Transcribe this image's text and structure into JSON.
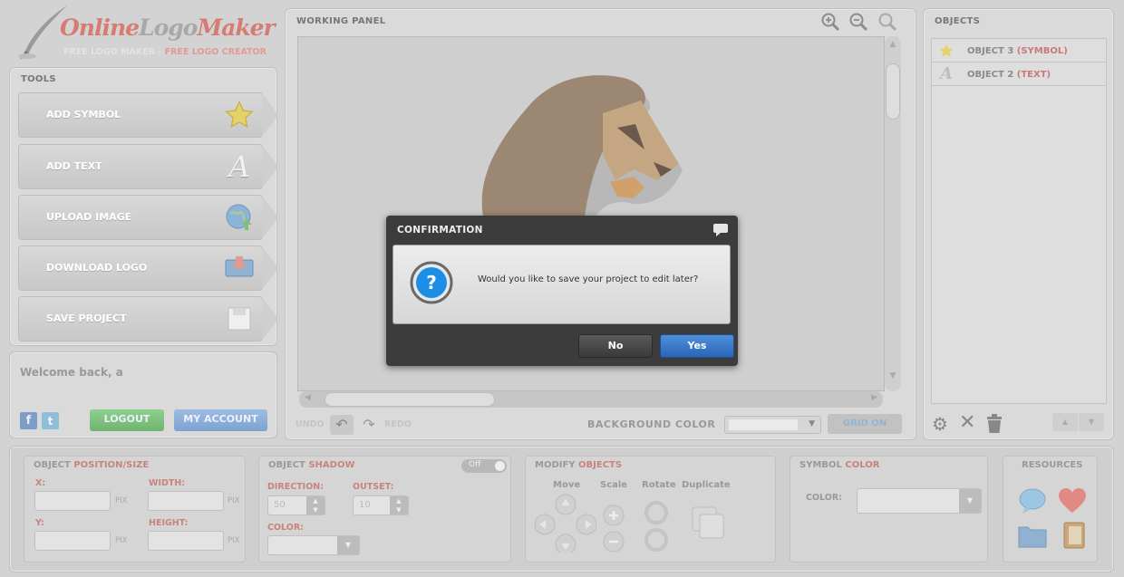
{
  "logo": {
    "brand_a": "Online",
    "brand_b": "Logo",
    "brand_c": "Maker",
    "sub_a": "FREE LOGO MAKER",
    "sub_sep": " - ",
    "sub_b": "FREE LOGO CREATOR"
  },
  "tools": {
    "title": "TOOLS",
    "items": [
      {
        "label": "ADD SYMBOL"
      },
      {
        "label": "ADD TEXT"
      },
      {
        "label": "UPLOAD IMAGE"
      },
      {
        "label": "DOWNLOAD LOGO"
      },
      {
        "label": "SAVE PROJECT"
      }
    ]
  },
  "account": {
    "welcome": "Welcome back, a",
    "logout": "LOGOUT",
    "my_account": "MY ACCOUNT"
  },
  "working": {
    "title": "WORKING PANEL",
    "undo": "UNDO",
    "redo": "REDO",
    "bg_label": "BACKGROUND COLOR",
    "grid": "GRID ON"
  },
  "objects": {
    "title": "OBJECTS",
    "items": [
      {
        "name": "OBJECT 3",
        "type": "(SYMBOL)"
      },
      {
        "name": "OBJECT 2",
        "type": "(TEXT)"
      }
    ]
  },
  "bottom": {
    "pos": {
      "title_a": "OBJECT ",
      "title_b": "POSITION/SIZE",
      "x": "X:",
      "y": "Y:",
      "width": "WIDTH:",
      "height": "HEIGHT:",
      "unit": "PIX"
    },
    "shadow": {
      "title_a": "OBJECT ",
      "title_b": "SHADOW",
      "toggle": "Off",
      "direction": "DIRECTION:",
      "outset": "OUTSET:",
      "dir_val": "50",
      "out_val": "10",
      "color": "COLOR:"
    },
    "modify": {
      "title_a": "MODIFY ",
      "title_b": "OBJECTS",
      "move": "Move",
      "scale": "Scale",
      "rotate": "Rotate",
      "duplicate": "Duplicate"
    },
    "symcolor": {
      "title_a": "SYMBOL ",
      "title_b": "COLOR",
      "color": "COLOR:"
    },
    "resources": {
      "title": "RESOURCES"
    }
  },
  "dialog": {
    "title": "CONFIRMATION",
    "message": "Would you like to save your project to edit later?",
    "no": "No",
    "yes": "Yes"
  },
  "colors": {
    "accent_red": "#d67c73",
    "green": "#7fbf7f",
    "blue": "#7ea6d6",
    "dialog_yes": "#2f6fc0"
  }
}
